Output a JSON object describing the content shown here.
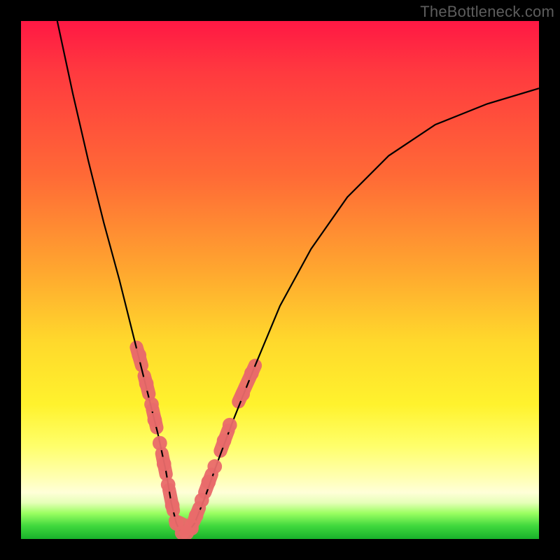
{
  "watermark": "TheBottleneck.com",
  "chart_data": {
    "type": "line",
    "title": "",
    "xlabel": "",
    "ylabel": "",
    "xlim": [
      0,
      100
    ],
    "ylim": [
      0,
      100
    ],
    "grid": false,
    "series": [
      {
        "name": "curve",
        "color": "#000000",
        "x": [
          7,
          10,
          13,
          16,
          19,
          21,
          23,
          25,
          26.5,
          28,
          29,
          30,
          31,
          32,
          33.5,
          35.5,
          38,
          41,
          45,
          50,
          56,
          63,
          71,
          80,
          90,
          100
        ],
        "y": [
          100,
          86,
          73,
          61,
          50,
          42,
          34,
          26,
          20,
          13,
          7,
          3,
          1,
          1,
          3,
          8,
          15,
          23,
          33,
          45,
          56,
          66,
          74,
          80,
          84,
          87
        ]
      }
    ],
    "highlight_points": {
      "name": "dots",
      "color": "#e96a6a",
      "radius_pct": 1.4,
      "points": [
        [
          22.8,
          35.5
        ],
        [
          24.2,
          30.0
        ],
        [
          25.2,
          26.0
        ],
        [
          25.8,
          23.0
        ],
        [
          26.8,
          18.5
        ],
        [
          27.6,
          14.5
        ],
        [
          28.4,
          10.5
        ],
        [
          29.2,
          6.5
        ],
        [
          30.0,
          3.0
        ],
        [
          31.1,
          1.2
        ],
        [
          32.0,
          1.2
        ],
        [
          32.9,
          2.5
        ],
        [
          33.8,
          4.5
        ],
        [
          34.9,
          7.5
        ],
        [
          36.2,
          11.0
        ],
        [
          37.4,
          14.0
        ],
        [
          39.2,
          19.0
        ],
        [
          40.3,
          22.0
        ],
        [
          42.8,
          28.0
        ],
        [
          44.5,
          32.0
        ]
      ]
    },
    "pill_segments": {
      "color": "#e96a6a",
      "width_pct": 2.6,
      "segments": [
        [
          [
            22.3,
            37.0
          ],
          [
            23.3,
            33.5
          ]
        ],
        [
          [
            23.8,
            31.5
          ],
          [
            24.7,
            28.0
          ]
        ],
        [
          [
            25.4,
            25.0
          ],
          [
            26.2,
            21.5
          ]
        ],
        [
          [
            27.2,
            16.5
          ],
          [
            28.0,
            12.5
          ]
        ],
        [
          [
            28.6,
            9.5
          ],
          [
            29.4,
            5.5
          ]
        ],
        [
          [
            29.8,
            3.5
          ],
          [
            33.0,
            2.0
          ]
        ],
        [
          [
            33.4,
            3.5
          ],
          [
            34.4,
            6.0
          ]
        ],
        [
          [
            35.5,
            9.0
          ],
          [
            36.8,
            12.5
          ]
        ],
        [
          [
            38.5,
            17.0
          ],
          [
            40.0,
            21.0
          ]
        ],
        [
          [
            42.0,
            26.5
          ],
          [
            45.2,
            33.5
          ]
        ]
      ]
    }
  }
}
